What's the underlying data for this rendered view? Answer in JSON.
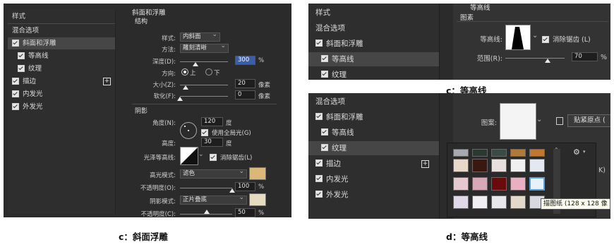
{
  "left": {
    "sidebar": {
      "title": "样式",
      "items": [
        {
          "label": "混合选项",
          "check": false,
          "indent": false,
          "sel": false,
          "plus": false
        },
        {
          "label": "斜面和浮雕",
          "check": true,
          "indent": false,
          "sel": true,
          "plus": false
        },
        {
          "label": "等高线",
          "check": true,
          "indent": true,
          "sel": false,
          "plus": false
        },
        {
          "label": "纹理",
          "check": true,
          "indent": true,
          "sel": false,
          "plus": false
        },
        {
          "label": "描边",
          "check": true,
          "indent": false,
          "sel": false,
          "plus": true
        },
        {
          "label": "内发光",
          "check": true,
          "indent": false,
          "sel": false,
          "plus": false
        },
        {
          "label": "外发光",
          "check": true,
          "indent": false,
          "sel": false,
          "plus": false
        }
      ]
    },
    "section_title": "斜面和浮雕",
    "structure": "结构",
    "style_label": "样式:",
    "style_value": "内斜面",
    "method_label": "方法:",
    "method_value": "雕刻清晰",
    "depth_label": "深度(D):",
    "depth_value": "300",
    "depth_unit": "%",
    "direction_label": "方向:",
    "up": "上",
    "down": "下",
    "size_label": "大小(Z):",
    "size_value": "20",
    "size_unit": "像素",
    "soften_label": "软化(F):",
    "soften_value": "0",
    "soften_unit": "像素",
    "shading": "阴影",
    "angle_label": "角度(N):",
    "angle_value": "120",
    "angle_unit": "度",
    "global_light": "使用全局光(G)",
    "altitude_label": "高度:",
    "altitude_value": "30",
    "altitude_unit": "度",
    "gloss_label": "光泽等高线:",
    "antialias": "消除锯齿(L)",
    "highlight_label": "高光模式:",
    "highlight_value": "滤色",
    "highlight_color": "#dcb878",
    "hl_opacity_label": "不透明度(O):",
    "hl_opacity_value": "100",
    "hl_opacity_unit": "%",
    "shadow_label": "阴影模式:",
    "shadow_value": "正片叠底",
    "shadow_color": "#e8dcc0",
    "sh_opacity_label": "不透明度(C):",
    "sh_opacity_value": "50",
    "sh_opacity_unit": "%"
  },
  "topright": {
    "items": [
      {
        "label": "样式",
        "check": false,
        "indent": false,
        "sel": false
      },
      {
        "label": "混合选项",
        "check": false,
        "indent": false,
        "sel": false
      },
      {
        "label": "斜面和浮雕",
        "check": true,
        "indent": false,
        "sel": false
      },
      {
        "label": "等高线",
        "check": true,
        "indent": true,
        "sel": true
      },
      {
        "label": "纹理",
        "check": true,
        "indent": true,
        "sel": false
      }
    ],
    "header_title": "等高线",
    "header_sub": "图素",
    "contour_label": "等高线:",
    "antialias": "消除锯齿 (L)",
    "range_label": "范围(R):",
    "range_value": "70",
    "range_unit": "%"
  },
  "bottomright": {
    "items": [
      {
        "label": "混合选项",
        "check": false,
        "indent": false,
        "sel": false,
        "plus": false
      },
      {
        "label": "斜面和浮雕",
        "check": true,
        "indent": false,
        "sel": false,
        "plus": false
      },
      {
        "label": "等高线",
        "check": true,
        "indent": true,
        "sel": false,
        "plus": false
      },
      {
        "label": "纹理",
        "check": true,
        "indent": true,
        "sel": true,
        "plus": false
      },
      {
        "label": "描边",
        "check": true,
        "indent": false,
        "sel": false,
        "plus": true
      },
      {
        "label": "内发光",
        "check": true,
        "indent": false,
        "sel": false,
        "plus": false
      },
      {
        "label": "外发光",
        "check": true,
        "indent": false,
        "sel": false,
        "plus": false
      }
    ],
    "pattern_label": "图案:",
    "snap_button": "贴紧原点 (",
    "partial_letter": "K)",
    "tooltip": "描图纸 (128 x 128 像",
    "swatch_colors": [
      [
        "#a8a8b0",
        "#2a3a30",
        "#3a4a44",
        "#b07a3a",
        "#c07830"
      ],
      [
        "#e8d8c8",
        "#3a1810",
        "#e8e0dc",
        "#f0f0f0",
        "#e4e8f0"
      ],
      [
        "#e8c8d0",
        "#d8a8b8",
        "#6a0a0a",
        "#e8b0c0",
        "#e8f0f8"
      ],
      [
        "#e0d8e8",
        "#f0eef2",
        "#e8e8ec",
        "#e4d8c8",
        "#d8d8e0"
      ]
    ]
  },
  "captions": {
    "c_top": "c：等高线",
    "c_bottom": "c：斜面浮雕",
    "d_bottom": "d：等高线"
  }
}
